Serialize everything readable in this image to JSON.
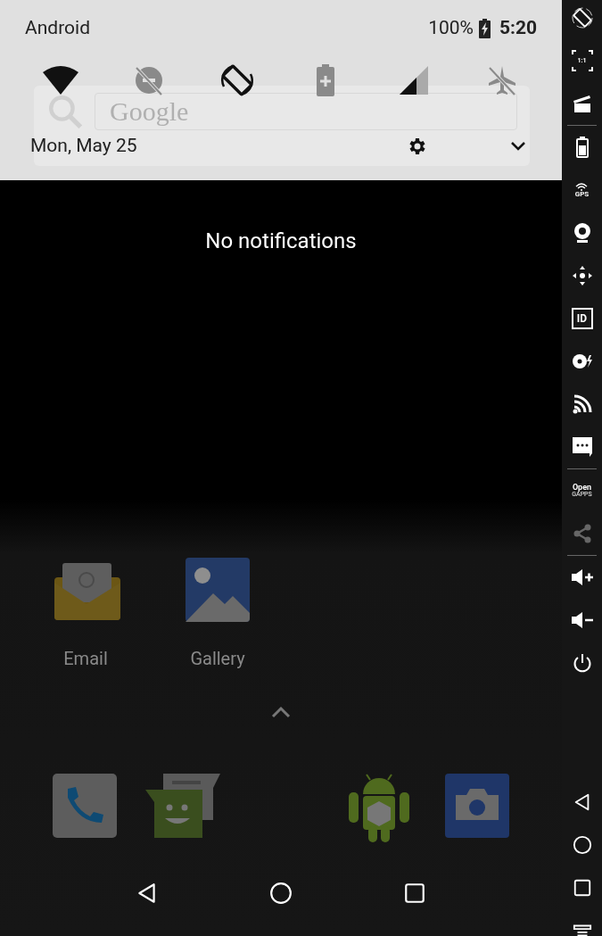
{
  "status_bar": {
    "carrier": "Android",
    "battery": "100%",
    "charging": true,
    "time": "5:20"
  },
  "quick_settings": [
    {
      "kind": "wifi",
      "on": true
    },
    {
      "kind": "dnd",
      "on": false
    },
    {
      "kind": "rotate",
      "on": true
    },
    {
      "kind": "battery_saver",
      "on": false
    },
    {
      "kind": "signal",
      "on": true
    },
    {
      "kind": "airplane",
      "on": false
    }
  ],
  "date": "Mon, May 25",
  "search_hint": "Google",
  "notifications": {
    "empty_text": "No notifications"
  },
  "home_apps": [
    {
      "kind": "email",
      "label": "Email"
    },
    {
      "kind": "gallery",
      "label": "Gallery"
    }
  ],
  "dock": [
    {
      "kind": "phone"
    },
    {
      "kind": "messaging"
    },
    {
      "kind": "spacer"
    },
    {
      "kind": "android"
    },
    {
      "kind": "camera"
    }
  ],
  "nav_bar": [
    {
      "kind": "back"
    },
    {
      "kind": "home"
    },
    {
      "kind": "recents"
    }
  ],
  "emulator_toolbar": {
    "top": [
      {
        "kind": "rotate"
      },
      {
        "kind": "fit",
        "label": "1:1"
      },
      {
        "kind": "clapper"
      },
      {
        "kind": "divider"
      },
      {
        "kind": "battery"
      },
      {
        "kind": "gps",
        "label": "GPS"
      },
      {
        "kind": "webcam"
      },
      {
        "kind": "dpad"
      },
      {
        "kind": "id",
        "label": "ID"
      },
      {
        "kind": "disk"
      },
      {
        "kind": "cast"
      },
      {
        "kind": "sms"
      },
      {
        "kind": "divider"
      },
      {
        "kind": "gapps",
        "label": "Open",
        "sublabel": "GAPPS"
      },
      {
        "kind": "share",
        "disabled": true
      },
      {
        "kind": "divider"
      },
      {
        "kind": "volume_up"
      },
      {
        "kind": "volume_down"
      },
      {
        "kind": "power"
      }
    ],
    "bottom": [
      {
        "kind": "back"
      },
      {
        "kind": "home"
      },
      {
        "kind": "recents"
      },
      {
        "kind": "menu"
      }
    ]
  }
}
